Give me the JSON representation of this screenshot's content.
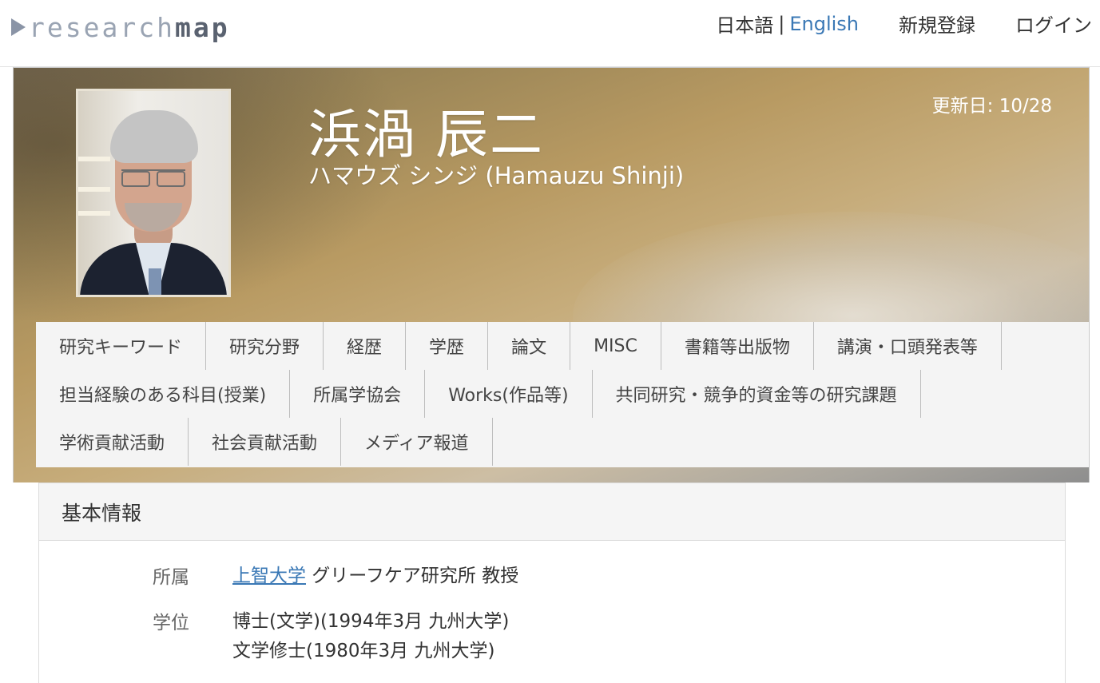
{
  "header": {
    "logo_part1": "research",
    "logo_part2": "map",
    "lang_ja": "日本語",
    "lang_sep": "|",
    "lang_en": "English",
    "register": "新規登録",
    "login": "ログイン"
  },
  "profile": {
    "name": "浜渦 辰二",
    "reading": "ハマウズ シンジ  (Hamauzu Shinji)",
    "updated": "更新日: 10/28"
  },
  "tabs": {
    "row1": [
      "研究キーワード",
      "研究分野",
      "経歴",
      "学歴",
      "論文",
      "MISC",
      "書籍等出版物",
      "講演・口頭発表等"
    ],
    "row2": [
      "担当経験のある科目(授業)",
      "所属学協会",
      "Works(作品等)",
      "共同研究・競争的資金等の研究課題"
    ],
    "row3": [
      "学術貢献活動",
      "社会貢献活動",
      "メディア報道"
    ]
  },
  "basic": {
    "title": "基本情報",
    "affiliation_label": "所属",
    "affiliation_link": "上智大学",
    "affiliation_rest": " グリーフケア研究所 教授",
    "degree_label": "学位",
    "degree1": "博士(文学)(1994年3月 九州大学)",
    "degree2": "文学修士(1980年3月 九州大学)"
  }
}
